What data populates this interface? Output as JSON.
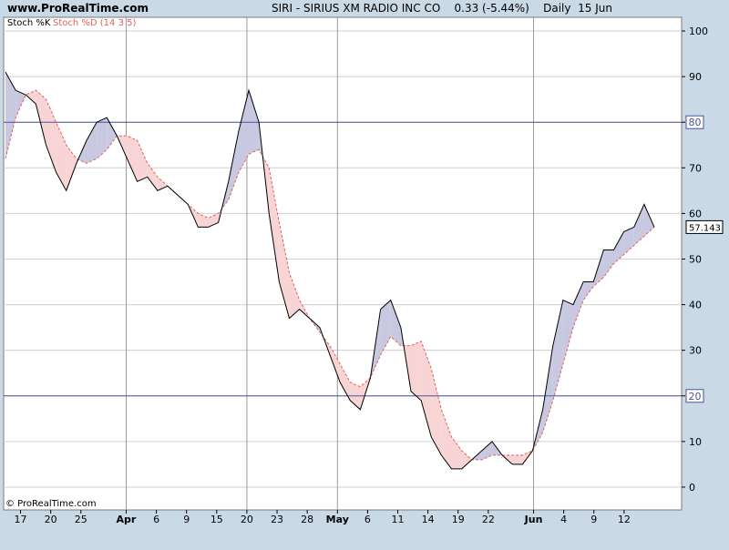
{
  "header": {
    "site": "www.ProRealTime.com",
    "title": "SIRI - SIRIUS XM RADIO INC CO    0.33 (-5.44%)    Daily  15 Jun"
  },
  "legend": {
    "k_label": "Stoch %K",
    "d_label": "Stoch %D (14 3 5)"
  },
  "copyright": "© ProRealTime.com",
  "colors": {
    "k_line": "#000000",
    "d_line": "#e06060",
    "fill_k_above": "#c8c8e0",
    "fill_d_above": "#f8d4d4",
    "reference": "#5050a0",
    "grid": "#cfcfcf",
    "axis_bg": "#c9d9e6"
  },
  "chart_data": {
    "type": "line",
    "ylim": [
      -5,
      103
    ],
    "yticks": [
      0,
      10,
      20,
      30,
      40,
      50,
      60,
      70,
      80,
      90,
      100
    ],
    "reference_lines": [
      80,
      20
    ],
    "last_value": "57.143",
    "x_labels": [
      {
        "label": "17",
        "idx": 1,
        "bold": false
      },
      {
        "label": "20",
        "idx": 3,
        "bold": false
      },
      {
        "label": "25",
        "idx": 5,
        "bold": false
      },
      {
        "label": "Apr",
        "idx": 8,
        "bold": true
      },
      {
        "label": "6",
        "idx": 10,
        "bold": false
      },
      {
        "label": "9",
        "idx": 12,
        "bold": false
      },
      {
        "label": "15",
        "idx": 14,
        "bold": false
      },
      {
        "label": "20",
        "idx": 16,
        "bold": false
      },
      {
        "label": "23",
        "idx": 18,
        "bold": false
      },
      {
        "label": "28",
        "idx": 20,
        "bold": false
      },
      {
        "label": "May",
        "idx": 22,
        "bold": true
      },
      {
        "label": "6",
        "idx": 24,
        "bold": false
      },
      {
        "label": "11",
        "idx": 26,
        "bold": false
      },
      {
        "label": "14",
        "idx": 28,
        "bold": false
      },
      {
        "label": "19",
        "idx": 30,
        "bold": false
      },
      {
        "label": "22",
        "idx": 32,
        "bold": false
      },
      {
        "label": "Jun",
        "idx": 35,
        "bold": true
      },
      {
        "label": "4",
        "idx": 37,
        "bold": false
      },
      {
        "label": "9",
        "idx": 39,
        "bold": false
      },
      {
        "label": "12",
        "idx": 41,
        "bold": false
      }
    ],
    "vgrid_idx": [
      8,
      16,
      22,
      35
    ],
    "series": [
      {
        "name": "Stoch %K",
        "values": [
          91,
          87,
          86,
          84,
          75,
          69,
          65,
          71,
          76,
          80,
          81,
          77,
          72,
          67,
          68,
          65,
          66,
          64,
          62,
          57,
          57,
          58,
          67,
          78,
          87,
          80,
          60,
          45,
          37,
          39,
          37,
          35,
          29,
          23,
          19,
          17,
          24,
          39,
          41,
          35,
          21,
          19,
          11,
          7,
          4,
          4,
          6,
          8,
          10,
          7,
          5,
          5,
          8,
          17,
          31,
          41,
          40,
          45,
          45,
          52,
          52,
          56,
          57,
          62,
          57
        ]
      },
      {
        "name": "Stoch %D (14 3 5)",
        "values": [
          72,
          81,
          86,
          87,
          85,
          80,
          75,
          72,
          71,
          72,
          74,
          77,
          77,
          76,
          71,
          68,
          66,
          64,
          62,
          60,
          59,
          60,
          63,
          69,
          73,
          74,
          70,
          58,
          47,
          41,
          37,
          34,
          31,
          27,
          23,
          22,
          24,
          29,
          33,
          31,
          31,
          32,
          26,
          17,
          11,
          8,
          6,
          6,
          7,
          7,
          7,
          7,
          8,
          12,
          19,
          27,
          35,
          41,
          44,
          46,
          49,
          51,
          53,
          55,
          57
        ]
      }
    ]
  }
}
